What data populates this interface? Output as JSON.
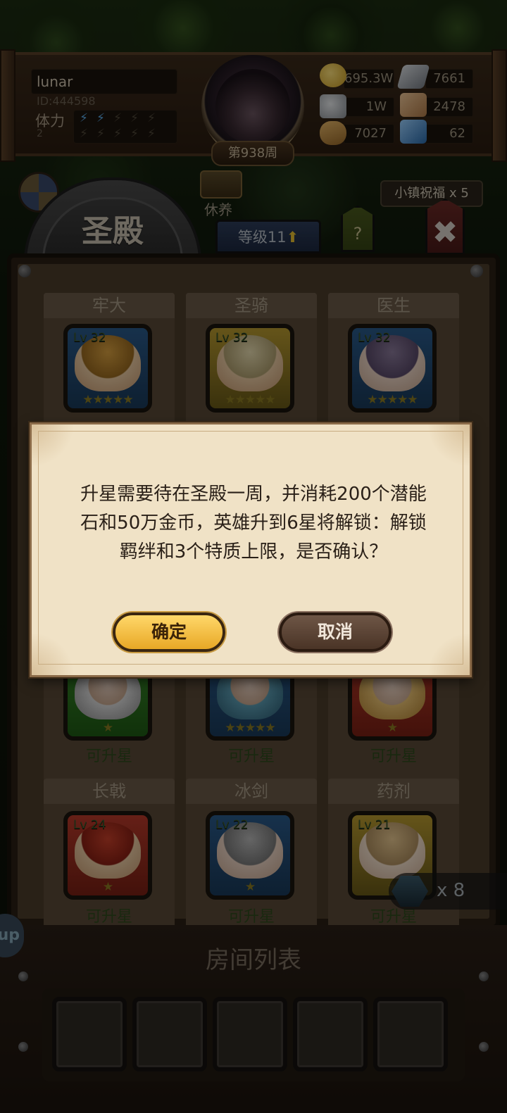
{
  "player": {
    "name": "lunar",
    "id": "ID:444598",
    "stamina_label": "体力",
    "stamina_value": "2",
    "week": "第938周"
  },
  "resources": {
    "gold": "695.3W",
    "iron": "7661",
    "stone": "1W",
    "cloth": "2478",
    "wood": "7027",
    "crystal": "62"
  },
  "nav": {
    "tab_title": "圣殿",
    "level": "等级11",
    "help": "?",
    "close": "✖",
    "rest_label": "休养",
    "town_blessing": "小镇祝福 x 5"
  },
  "hero_columns": [
    {
      "title": "牢大",
      "level": "Lv 32",
      "stars": "★★★★★",
      "hair": "#d8a040",
      "border": "#2a5a8a"
    },
    {
      "title": "圣骑",
      "level": "Lv 32",
      "stars": "★★★★★",
      "hair": "#e8dcb0",
      "border": "#b89a30"
    },
    {
      "title": "医生",
      "level": "Lv 32",
      "stars": "★★★★★",
      "hair": "#8a7a9a",
      "border": "#2a5a8a"
    }
  ],
  "hero_row2": [
    {
      "stars": "★",
      "status": "可升星",
      "hair": "#d8d8d8",
      "border": "#3a8a2a"
    },
    {
      "stars": "★★★★★",
      "status": "可升星",
      "hair": "#5a9ab0",
      "border": "#2a5a8a"
    },
    {
      "stars": "★",
      "status": "可升星",
      "hair": "#e8c070",
      "border": "#b83a2a"
    }
  ],
  "hero_row3": [
    {
      "title": "长戟",
      "level": "Lv 24",
      "stars": "★",
      "status": "可升星",
      "hair": "#c8402a",
      "border": "#b83a2a"
    },
    {
      "title": "冰剑",
      "level": "Lv 22",
      "stars": "★",
      "status": "可升星",
      "hair": "#b8b8b8",
      "border": "#2a5a8a"
    },
    {
      "title": "药剂",
      "level": "Lv 21",
      "stars": "★",
      "status": "可升星",
      "hair": "#e8c890",
      "border": "#b89a30"
    }
  ],
  "gem_count": "x 8",
  "side_button": "up",
  "room_list_title": "房间列表",
  "dialog": {
    "message_line1": "升星需要待在圣殿一周，并消耗200个潜能",
    "message_line2": "石和50万金币，英雄升到6星将解锁：解锁",
    "message_line3": "羁绊和3个特质上限，是否确认？",
    "confirm": "确定",
    "cancel": "取消"
  },
  "colors": {
    "confirm_gold": "#e8a826",
    "cancel_brown": "#4a3426",
    "parchment": "#f0e2c6"
  }
}
